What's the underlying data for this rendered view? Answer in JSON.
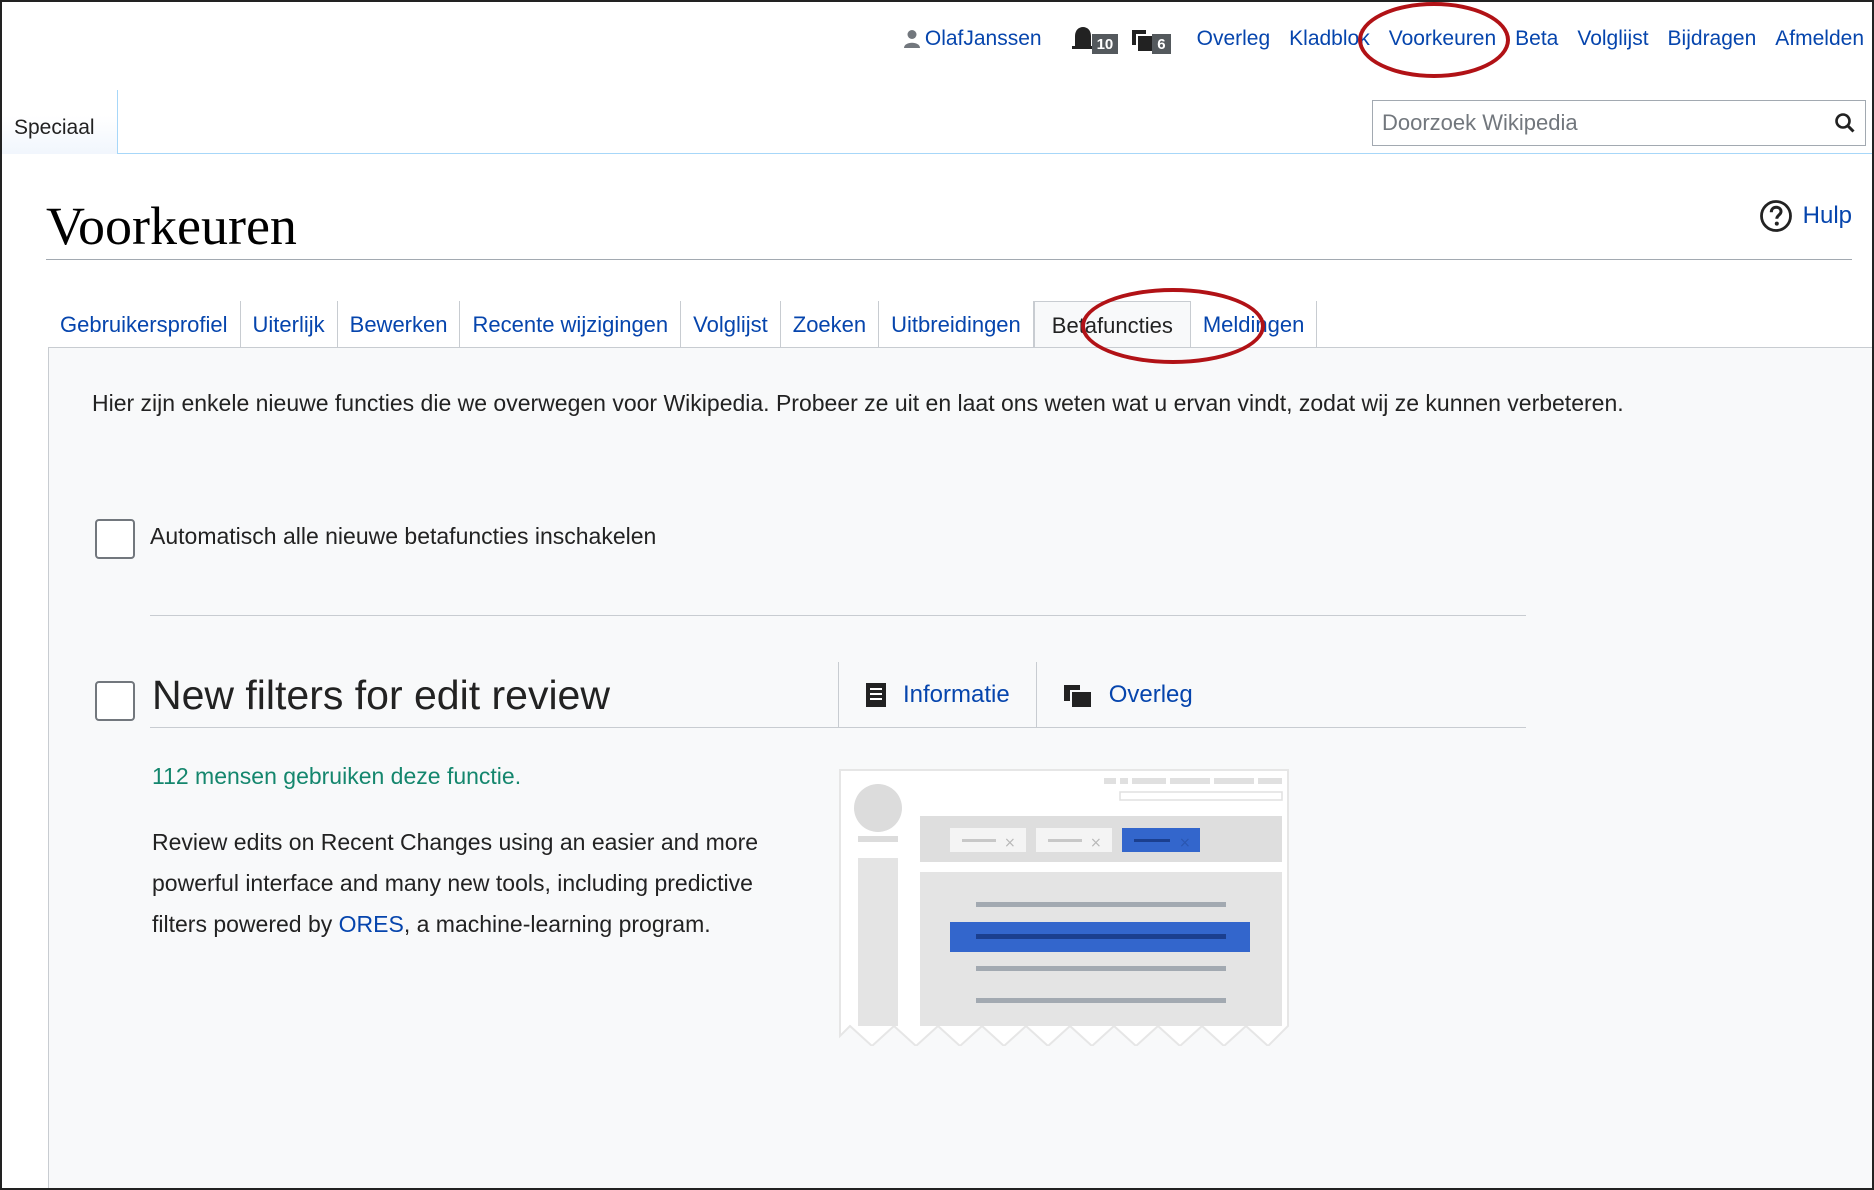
{
  "personal": {
    "username": "OlafJanssen",
    "alerts_count": "10",
    "notices_count": "6",
    "links": [
      "Overleg",
      "Kladblok",
      "Voorkeuren",
      "Beta",
      "Volglijst",
      "Bijdragen",
      "Afmelden"
    ]
  },
  "namespace_tab": "Speciaal",
  "search": {
    "placeholder": "Doorzoek Wikipedia"
  },
  "page": {
    "title": "Voorkeuren",
    "help": "Hulp"
  },
  "tabs": [
    "Gebruikersprofiel",
    "Uiterlijk",
    "Bewerken",
    "Recente wijzigingen",
    "Volglijst",
    "Zoeken",
    "Uitbreidingen",
    "Betafuncties",
    "Meldingen"
  ],
  "active_tab": "Betafuncties",
  "beta": {
    "intro": "Hier zijn enkele nieuwe functies die we overwegen voor Wikipedia. Probeer ze uit en laat ons weten wat u ervan vindt, zodat wij ze kunnen verbeteren.",
    "auto_enable_label": "Automatisch alle nieuwe betafuncties inschakelen",
    "feature": {
      "title": "New filters for edit review",
      "info_link": "Informatie",
      "talk_link": "Overleg",
      "users": "112 mensen gebruiken deze functie.",
      "desc_before": "Review edits on Recent Changes using an easier and more powerful interface and many new tools, including predictive filters powered by ",
      "desc_link": "ORES",
      "desc_after": ", a machine-learning program."
    }
  },
  "colors": {
    "link": "#0645ad",
    "highlight_ring": "#b11216",
    "users_green": "#14866d"
  }
}
